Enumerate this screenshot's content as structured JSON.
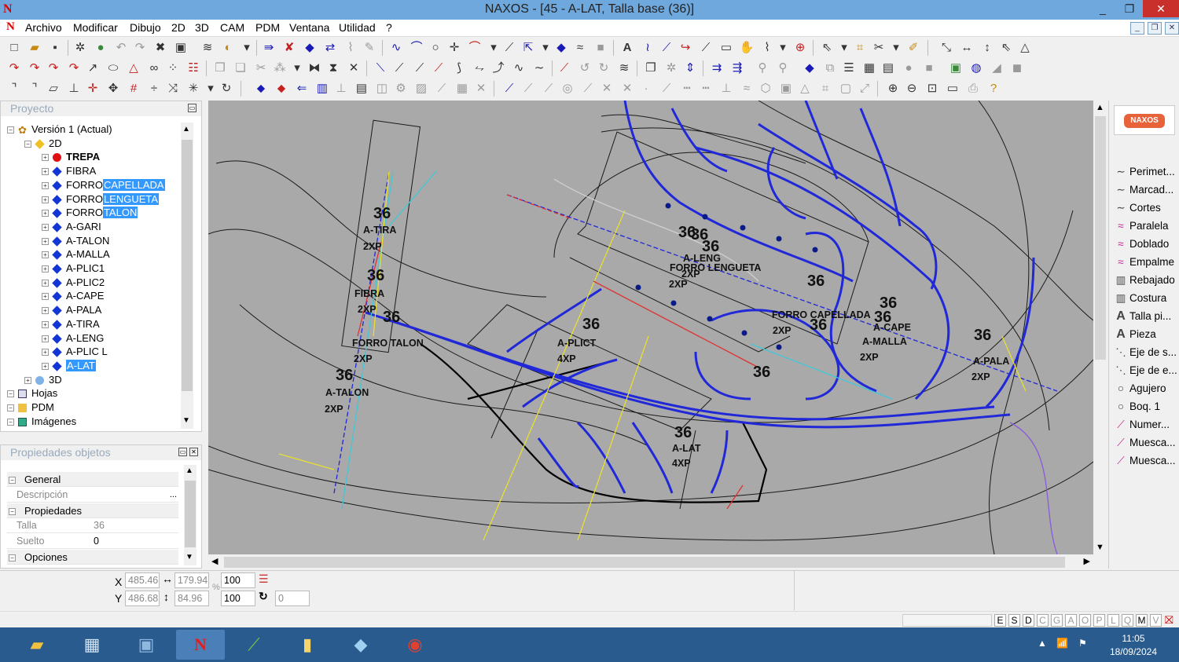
{
  "window": {
    "title": "NAXOS - [45 - A-LAT, Talla base (36)]",
    "controls": [
      "_",
      "❐",
      "✕"
    ]
  },
  "menu": [
    "Archivo",
    "Modificar",
    "Dibujo",
    "2D",
    "3D",
    "CAM",
    "PDM",
    "Ventana",
    "Utilidad",
    "?"
  ],
  "project_panel": {
    "title": "Proyecto",
    "tree": [
      {
        "label": "Versión 1 (Actual)",
        "level": 0,
        "icon": "version-icon"
      },
      {
        "label": "2D",
        "level": 1,
        "icon": "layer-2d-icon"
      },
      {
        "label": "TREPA",
        "level": 2,
        "icon": "red-dot-icon",
        "bold": true
      },
      {
        "label": "FIBRA",
        "level": 2,
        "icon": "blue-diamond-icon"
      },
      {
        "label": "FORRO",
        "sel": "CAPELLADA",
        "level": 2,
        "icon": "blue-diamond-icon"
      },
      {
        "label": "FORRO",
        "sel": "LENGUETA",
        "level": 2,
        "icon": "blue-diamond-icon"
      },
      {
        "label": "FORRO",
        "sel": "TALON",
        "level": 2,
        "icon": "blue-diamond-icon"
      },
      {
        "label": "A-GARI",
        "level": 2,
        "icon": "blue-diamond-icon"
      },
      {
        "label": "A-TALON",
        "level": 2,
        "icon": "blue-diamond-icon"
      },
      {
        "label": "A-MALLA",
        "level": 2,
        "icon": "blue-diamond-icon"
      },
      {
        "label": "A-PLIC1",
        "level": 2,
        "icon": "blue-diamond-icon"
      },
      {
        "label": "A-PLIC2",
        "level": 2,
        "icon": "blue-diamond-icon"
      },
      {
        "label": "A-CAPE",
        "level": 2,
        "icon": "blue-diamond-icon"
      },
      {
        "label": "A-PALA",
        "level": 2,
        "icon": "blue-diamond-icon"
      },
      {
        "label": "A-TIRA",
        "level": 2,
        "icon": "blue-diamond-icon"
      },
      {
        "label": "A-LENG",
        "level": 2,
        "icon": "blue-diamond-icon"
      },
      {
        "label": "A-PLIC L",
        "level": 2,
        "icon": "blue-diamond-icon"
      },
      {
        "label": "",
        "sel": "A-LAT",
        "level": 2,
        "icon": "blue-diamond-icon"
      },
      {
        "label": "3D",
        "level": 1,
        "icon": "layer-3d-icon"
      },
      {
        "label": "Hojas",
        "level": 0,
        "icon": "sheets-icon"
      },
      {
        "label": "PDM",
        "level": 0,
        "icon": "folder-icon"
      },
      {
        "label": "Imágenes",
        "level": 0,
        "icon": "images-icon"
      }
    ]
  },
  "properties_panel": {
    "title": "Propiedades objetos",
    "rows": [
      {
        "type": "group",
        "label": "General"
      },
      {
        "type": "field",
        "key": "Descripción",
        "value": ""
      },
      {
        "type": "group",
        "label": "Propiedades"
      },
      {
        "type": "field",
        "key": "Talla",
        "value": "36"
      },
      {
        "type": "field",
        "key": "Suelto",
        "value": "0"
      },
      {
        "type": "group",
        "label": "Opciones"
      }
    ]
  },
  "canvas": {
    "labels": [
      {
        "t": "36",
        "big": true
      },
      {
        "t": "A-TIRA"
      },
      {
        "t": "2XP"
      },
      {
        "t": "36",
        "big": true
      },
      {
        "t": "FIBRA"
      },
      {
        "t": "2XP"
      },
      {
        "t": "36",
        "big": true
      },
      {
        "t": "FORRO TALON"
      },
      {
        "t": "2XP"
      },
      {
        "t": "36",
        "big": true
      },
      {
        "t": "A-TALON"
      },
      {
        "t": "2XP"
      },
      {
        "t": "36",
        "big": true
      },
      {
        "t": "36",
        "big": true
      },
      {
        "t": "36",
        "big": true
      },
      {
        "t": "A-LENG"
      },
      {
        "t": "FORRO LENGUETA"
      },
      {
        "t": "2XP"
      },
      {
        "t": "2XP"
      },
      {
        "t": "36",
        "big": true
      },
      {
        "t": "A-PLICT"
      },
      {
        "t": "4XP"
      },
      {
        "t": "36",
        "big": true
      },
      {
        "t": "FORRO CAPELLADA"
      },
      {
        "t": "36",
        "big": true
      },
      {
        "t": "2XP"
      },
      {
        "t": "36",
        "big": true
      },
      {
        "t": "36",
        "big": true
      },
      {
        "t": "A-CAPE"
      },
      {
        "t": "A-MALLA"
      },
      {
        "t": "2XP"
      },
      {
        "t": "36",
        "big": true
      },
      {
        "t": "A-PALA"
      },
      {
        "t": "2XP"
      },
      {
        "t": "36",
        "big": true
      },
      {
        "t": "A-LAT"
      },
      {
        "t": "4XP"
      },
      {
        "t": "36",
        "big": true
      }
    ]
  },
  "right_panel": {
    "logo": "NAXOS",
    "items": [
      {
        "label": "Perimet...",
        "icon": "perimeter-icon"
      },
      {
        "label": "Marcad...",
        "icon": "marker-icon"
      },
      {
        "label": "Cortes",
        "icon": "cuts-icon"
      },
      {
        "label": "Paralela",
        "icon": "parallel-icon"
      },
      {
        "label": "Doblado",
        "icon": "fold-icon"
      },
      {
        "label": "Empalme",
        "icon": "splice-icon"
      },
      {
        "label": "Rebajado",
        "icon": "skive-icon"
      },
      {
        "label": "Costura",
        "icon": "seam-icon"
      },
      {
        "label": "Talla pi...",
        "icon": "size-text-icon"
      },
      {
        "label": "Pieza",
        "icon": "piece-text-icon"
      },
      {
        "label": "Eje de s...",
        "icon": "axis-icon"
      },
      {
        "label": "Eje de e...",
        "icon": "axis-icon"
      },
      {
        "label": "Agujero",
        "icon": "hole-icon"
      },
      {
        "label": "Boq. 1",
        "icon": "hole-icon"
      },
      {
        "label": "Numer...",
        "icon": "number-icon"
      },
      {
        "label": "Muesca...",
        "icon": "notch-icon"
      },
      {
        "label": "Muesca...",
        "icon": "notch-icon"
      }
    ]
  },
  "coords": {
    "x_label": "X",
    "y_label": "Y",
    "x": "485.46",
    "y": "486.68",
    "w": "179.94",
    "h": "84.96",
    "scale_x": "100",
    "scale_y": "100",
    "angle": "0"
  },
  "status_letters": [
    "E",
    "S",
    "D",
    "C",
    "G",
    "A",
    "O",
    "P",
    "L",
    "Q",
    "M",
    "V"
  ],
  "taskbar": {
    "time": "11:05",
    "date": "18/09/2024"
  }
}
